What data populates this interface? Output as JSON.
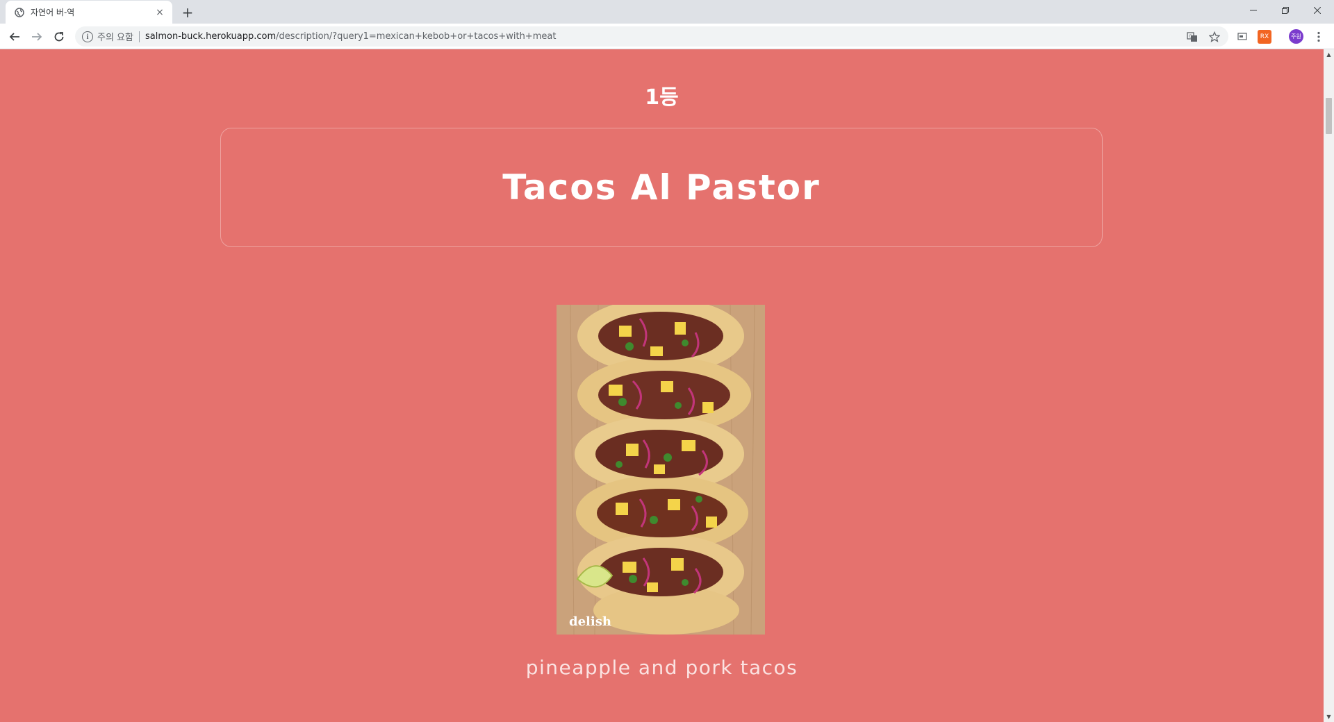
{
  "browser": {
    "tab_title": "자연어 버-역",
    "new_tab": "+",
    "tab_close": "×",
    "security_status": "주의 요함",
    "url_host": "salmon-buck.herokuapp.com",
    "url_path": "/description/?query1=mexican+kebob+or+tacos+with+meat",
    "profile_initials": "주원",
    "ext_label": "RX"
  },
  "page": {
    "rank": "1등",
    "dish_name": "Tacos Al Pastor",
    "photo_watermark": "delish",
    "description": "pineapple and pork tacos"
  },
  "colors": {
    "page_background": "#e5726e",
    "text": "#ffffff"
  }
}
